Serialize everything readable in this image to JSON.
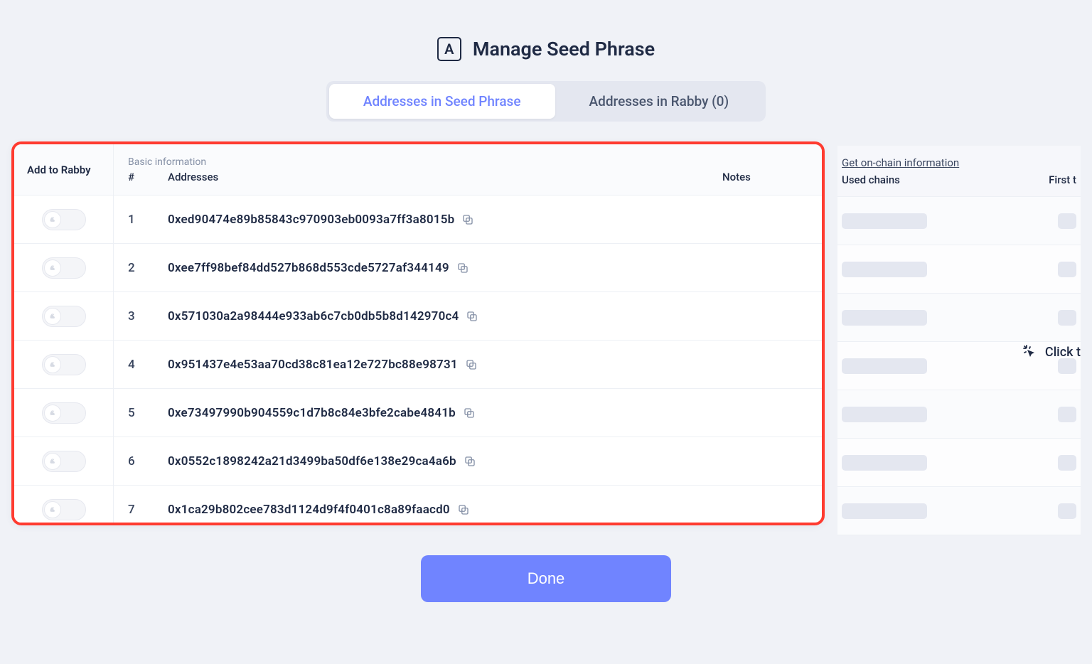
{
  "header": {
    "icon_letter": "A",
    "title": "Manage Seed Phrase"
  },
  "tabs": {
    "active": "Addresses in Seed Phrase",
    "inactive": "Addresses in Rabby (0)"
  },
  "columns": {
    "add_to_rabby": "Add to Rabby",
    "basic_info": "Basic information",
    "num": "#",
    "addresses": "Addresses",
    "notes": "Notes"
  },
  "rows": [
    {
      "index": "1",
      "address": "0xed90474e89b85843c970903eb0093a7ff3a8015b"
    },
    {
      "index": "2",
      "address": "0xee7ff98bef84dd527b868d553cde5727af344149"
    },
    {
      "index": "3",
      "address": "0x571030a2a98444e933ab6c7cb0db5b8d142970c4"
    },
    {
      "index": "4",
      "address": "0x951437e4e53aa70cd38c81ea12e727bc88e98731"
    },
    {
      "index": "5",
      "address": "0xe73497990b904559c1d7b8c84e3bfe2cabe4841b"
    },
    {
      "index": "6",
      "address": "0x0552c1898242a21d3499ba50df6e138e29ca4a6b"
    },
    {
      "index": "7",
      "address": "0x1ca29b802cee783d1124d9f4f0401c8a89faacd0"
    }
  ],
  "side": {
    "get_onchain": "Get on-chain information",
    "used_chains": "Used chains",
    "first_t": "First t",
    "hint": "Click t"
  },
  "done": "Done"
}
